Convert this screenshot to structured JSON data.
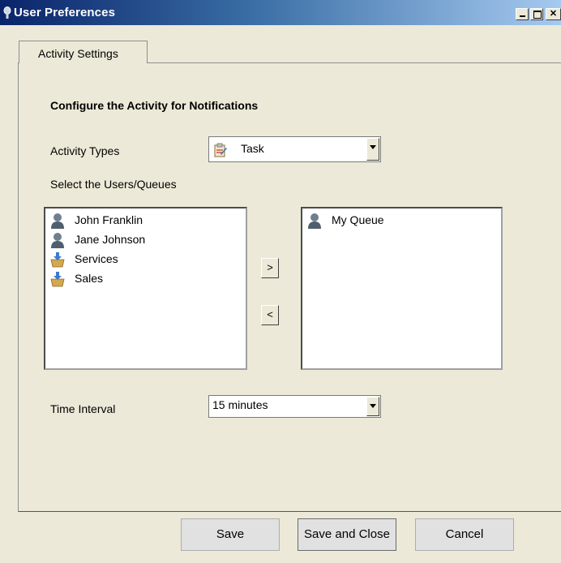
{
  "window": {
    "title": "User Preferences"
  },
  "tabs": [
    {
      "label": "Activity Settings"
    }
  ],
  "section": {
    "heading": "Configure the Activity for Notifications"
  },
  "activity_types": {
    "label": "Activity Types",
    "selected": "Task"
  },
  "users_queues": {
    "label": "Select the Users/Queues",
    "available": [
      {
        "label": "John Franklin",
        "icon": "user-icon"
      },
      {
        "label": "Jane Johnson",
        "icon": "user-icon"
      },
      {
        "label": "Services",
        "icon": "queue-icon"
      },
      {
        "label": "Sales",
        "icon": "queue-icon"
      }
    ],
    "selected": [
      {
        "label": "My Queue",
        "icon": "user-icon"
      }
    ],
    "add_label": ">",
    "remove_label": "<"
  },
  "time_interval": {
    "label": "Time Interval",
    "selected": "15 minutes"
  },
  "footer": {
    "save_label": "Save",
    "save_close_label": "Save and Close",
    "cancel_label": "Cancel"
  },
  "colors": {
    "titlebar_start": "#0a246a",
    "titlebar_end": "#a6caf0",
    "background": "#ece9d8"
  }
}
